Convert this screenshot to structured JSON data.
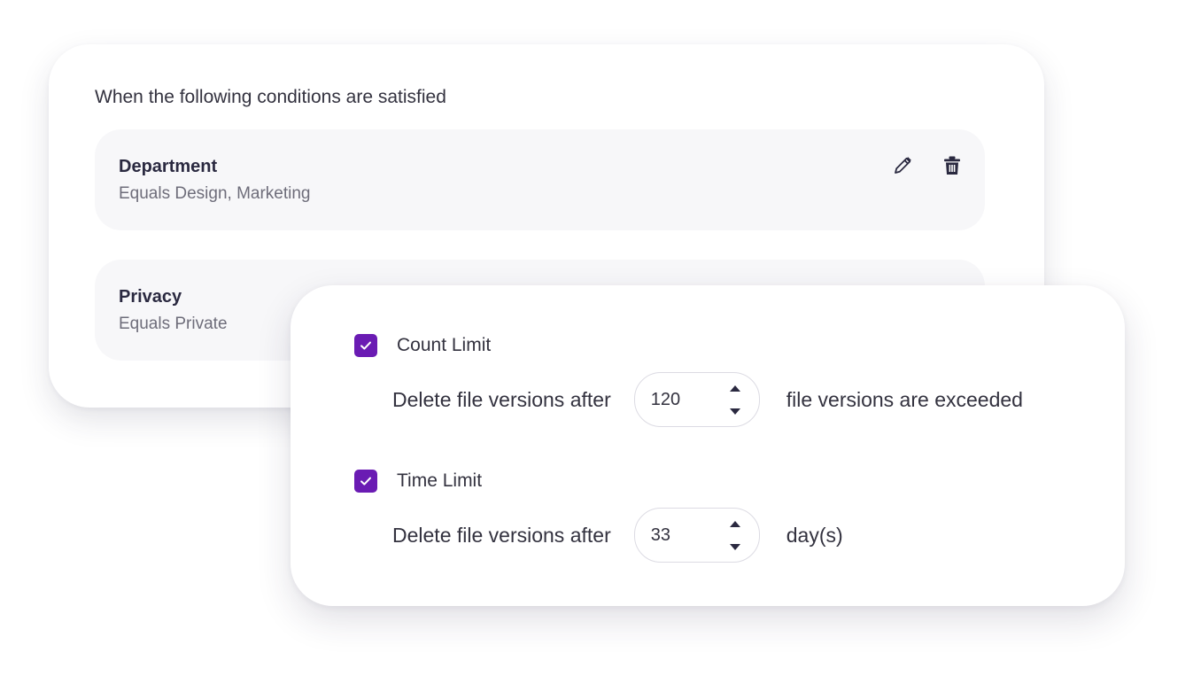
{
  "conditions": {
    "heading": "When the following conditions are satisfied",
    "rows": [
      {
        "title": "Department",
        "description": "Equals Design, Marketing"
      },
      {
        "title": "Privacy",
        "description": "Equals Private"
      }
    ],
    "actions": {
      "edit_icon": "pencil-icon",
      "delete_icon": "trash-icon"
    }
  },
  "limits": {
    "count": {
      "checked": true,
      "label": "Count Limit",
      "prefix": "Delete file versions after",
      "value": "120",
      "suffix": "file versions are exceeded"
    },
    "time": {
      "checked": true,
      "label": "Time Limit",
      "prefix": "Delete file versions after",
      "value": "33",
      "suffix": "day(s)"
    }
  },
  "colors": {
    "accent": "#6a1bb3",
    "row_background": "#f7f7f9",
    "text": "#33323f",
    "muted_text": "#6e6d7a"
  }
}
